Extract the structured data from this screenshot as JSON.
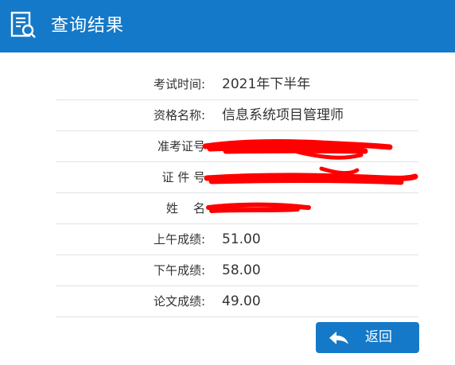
{
  "header": {
    "title": "查询结果",
    "icon": "document-search-icon",
    "background_color": "#1479c8"
  },
  "rows": [
    {
      "label": "考试时间:",
      "value": "2021年下半年"
    },
    {
      "label": "资格名称:",
      "value": "信息系统项目管理师"
    },
    {
      "label": "准考证号",
      "value": ""
    },
    {
      "label": "证 件 号",
      "value": ""
    },
    {
      "label": "姓    名",
      "value": ""
    },
    {
      "label": "上午成绩:",
      "value": "51.00"
    },
    {
      "label": "下午成绩:",
      "value": "58.00"
    },
    {
      "label": "论文成绩:",
      "value": "49.00"
    }
  ],
  "back_button": {
    "label": "返回",
    "icon": "back-arrow-icon"
  },
  "redaction_color": "#ff0000"
}
